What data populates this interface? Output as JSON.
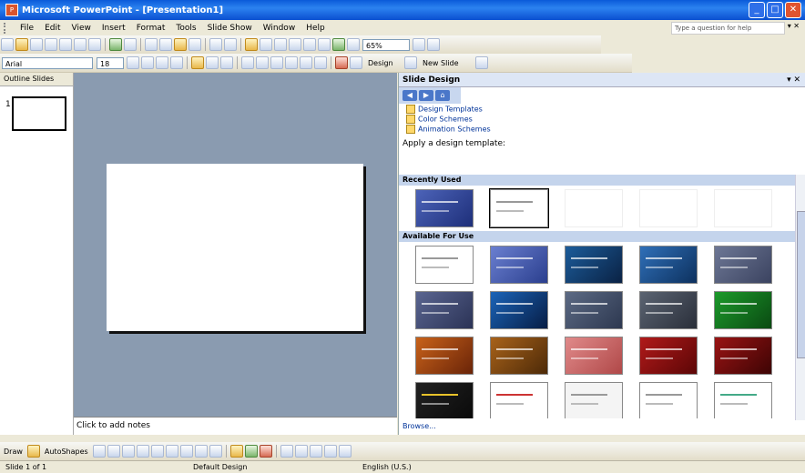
{
  "window": {
    "title": "Microsoft PowerPoint - [Presentation1]"
  },
  "menubar": {
    "items": [
      "File",
      "Edit",
      "View",
      "Insert",
      "Format",
      "Tools",
      "Slide Show",
      "Window",
      "Help"
    ],
    "help_prompt": "Type a question for help"
  },
  "toolbar": {
    "zoom": "65%",
    "font_name": "Arial",
    "font_size": "18",
    "design_label": "Design",
    "new_slide_label": "New Slide"
  },
  "outline_tabs": "Outline  Slides",
  "notes": {
    "placeholder": "Click to add notes"
  },
  "taskpane": {
    "title": "Slide Design",
    "links": [
      "Design Templates",
      "Color Schemes",
      "Animation Schemes"
    ],
    "apply_label": "Apply a design template:",
    "recently_used": "Recently Used",
    "available": "Available For Use",
    "browse": "Browse..."
  },
  "drawbar": {
    "draw": "Draw",
    "autoshapes": "AutoShapes"
  },
  "statusbar": {
    "slide": "Slide 1 of 1",
    "design": "Default Design",
    "language": "English (U.S.)"
  }
}
